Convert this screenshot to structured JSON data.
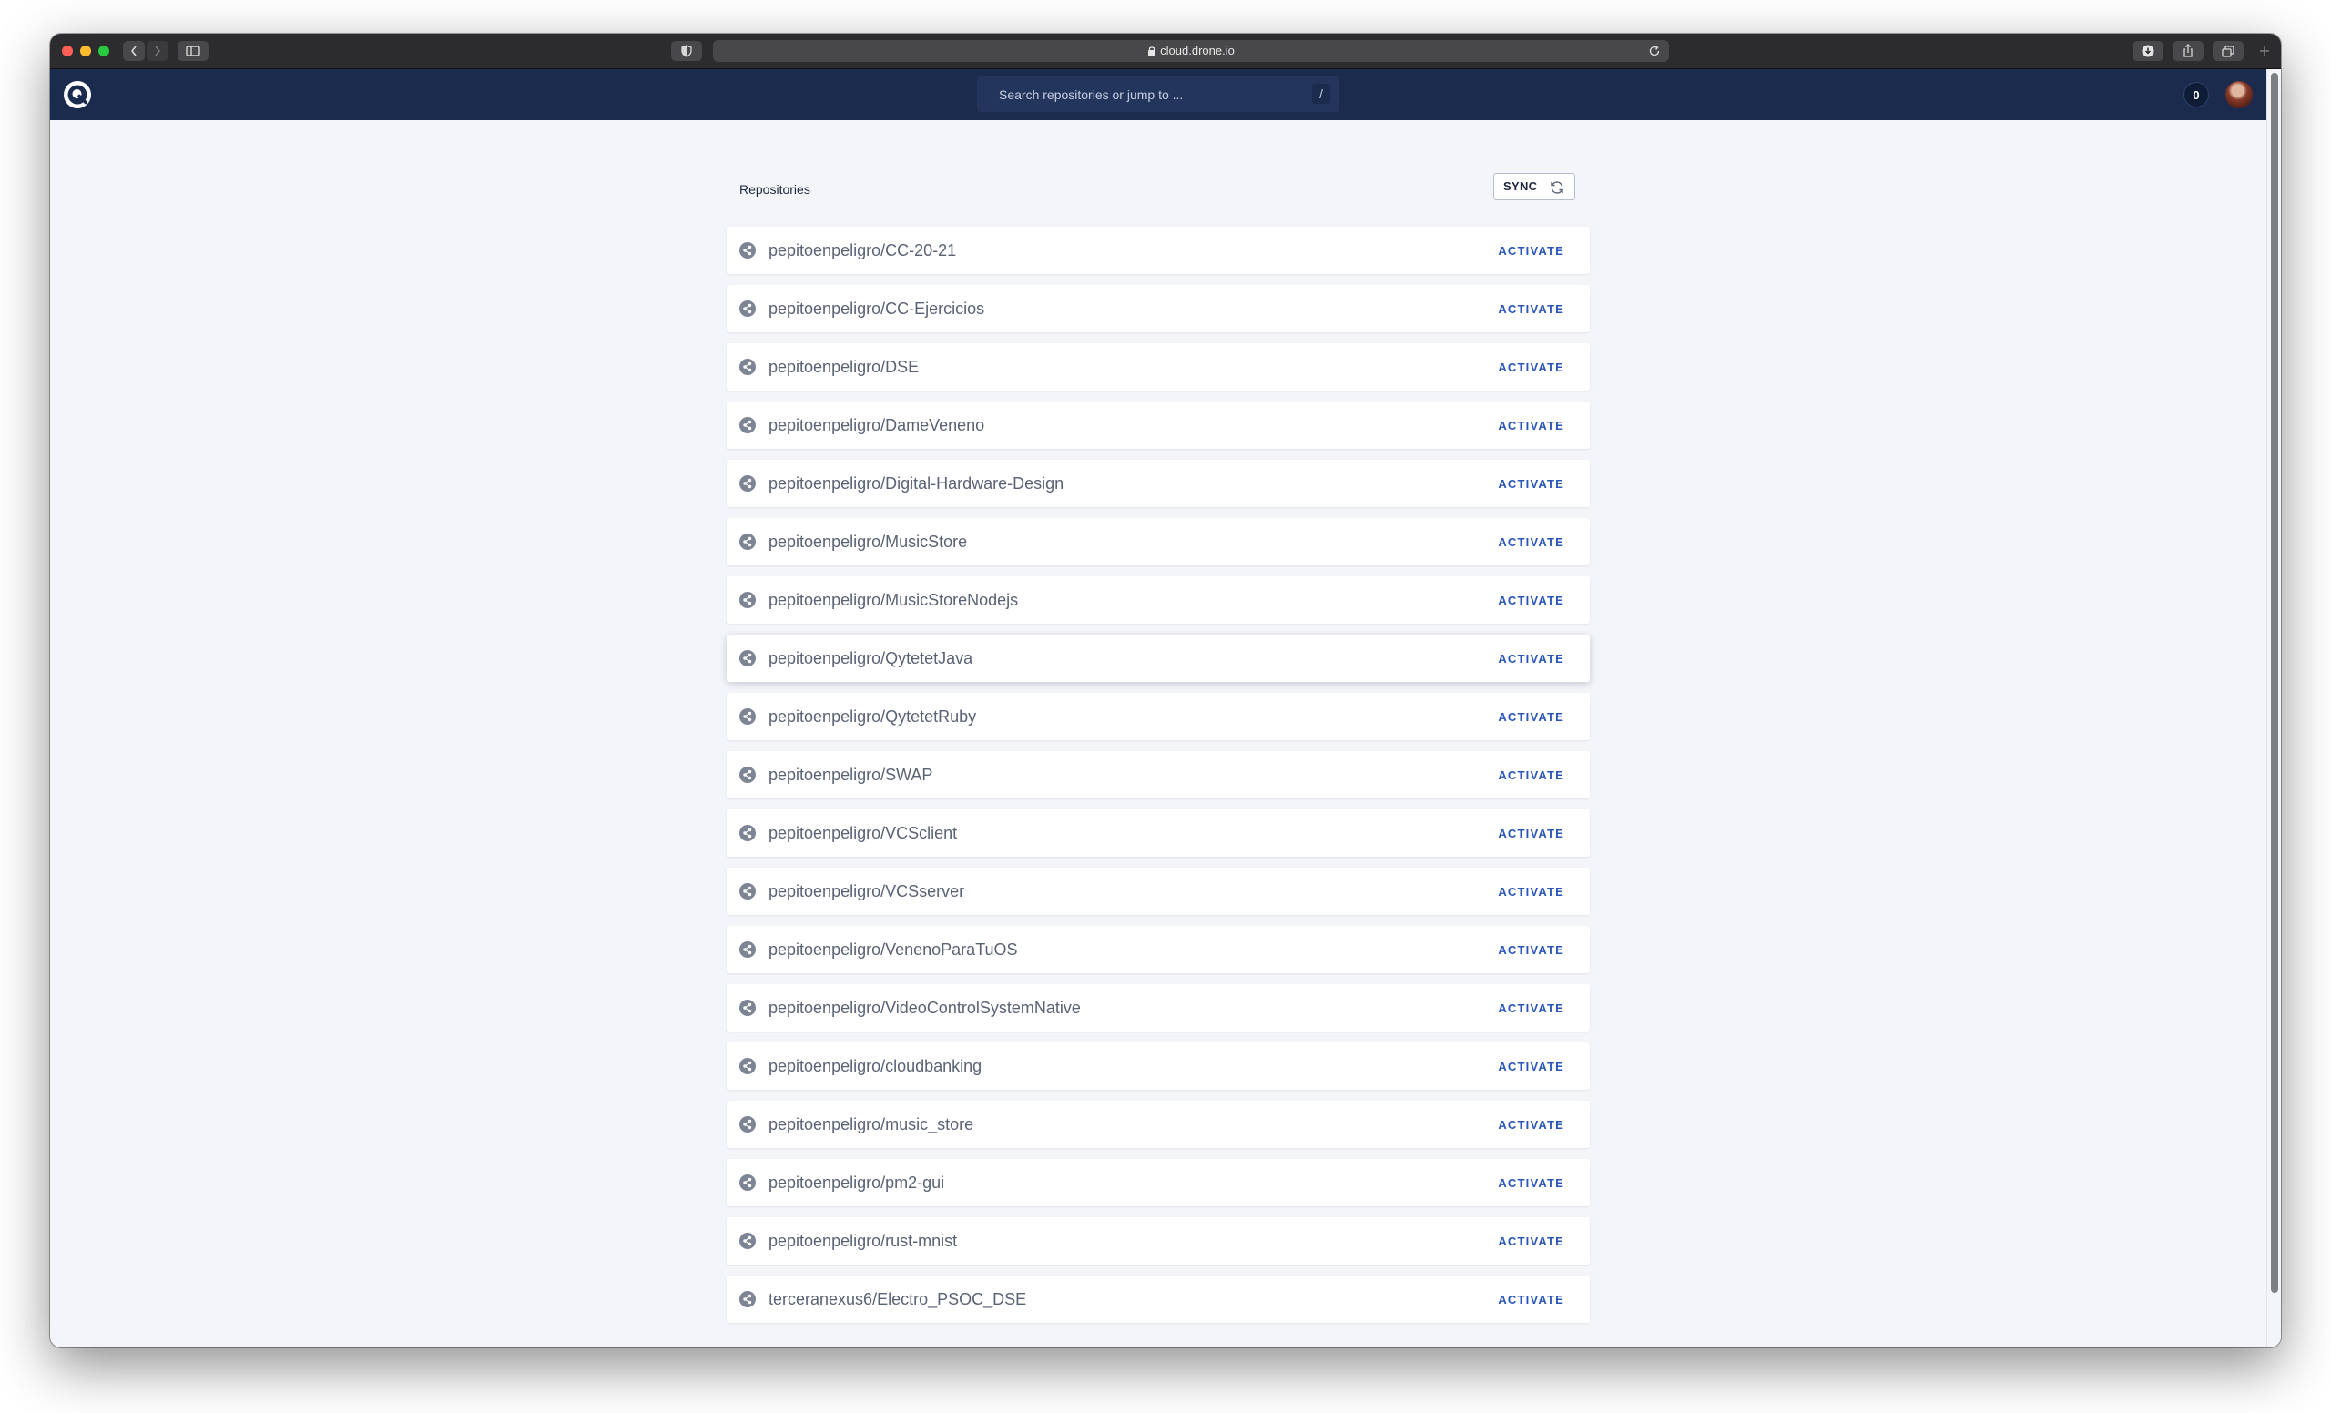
{
  "browser": {
    "url": "cloud.drone.io"
  },
  "header": {
    "search_placeholder": "Search repositories or jump to ...",
    "search_shortcut": "/",
    "notification_count": "0"
  },
  "main": {
    "title": "Repositories",
    "sync_label": "SYNC",
    "activate_label": "ACTIVATE",
    "repos": [
      "pepitoenpeligro/CC-20-21",
      "pepitoenpeligro/CC-Ejercicios",
      "pepitoenpeligro/DSE",
      "pepitoenpeligro/DameVeneno",
      "pepitoenpeligro/Digital-Hardware-Design",
      "pepitoenpeligro/MusicStore",
      "pepitoenpeligro/MusicStoreNodejs",
      "pepitoenpeligro/QytetetJava",
      "pepitoenpeligro/QytetetRuby",
      "pepitoenpeligro/SWAP",
      "pepitoenpeligro/VCSclient",
      "pepitoenpeligro/VCSserver",
      "pepitoenpeligro/VenenoParaTuOS",
      "pepitoenpeligro/VideoControlSystemNative",
      "pepitoenpeligro/cloudbanking",
      "pepitoenpeligro/music_store",
      "pepitoenpeligro/pm2-gui",
      "pepitoenpeligro/rust-mnist",
      "terceranexus6/Electro_PSOC_DSE"
    ]
  },
  "colors": {
    "header_bg": "#1b2b4e",
    "page_bg": "#f4f5f9",
    "accent": "#2a56b8"
  }
}
